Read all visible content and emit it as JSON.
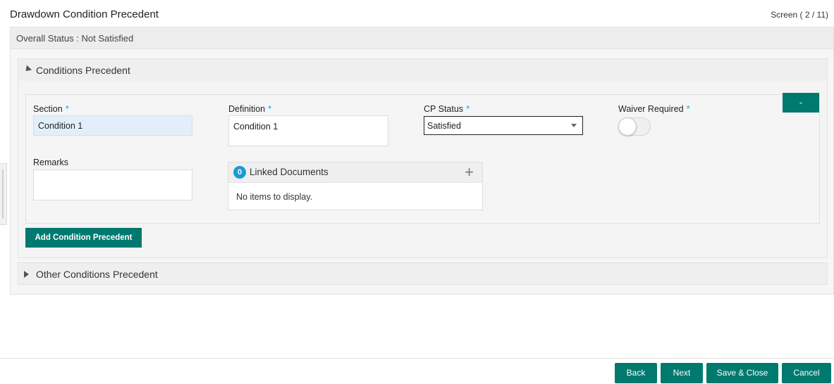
{
  "header": {
    "title": "Drawdown Condition Precedent",
    "screen_counter": "Screen ( 2 / 11)"
  },
  "overall_status": "Overall Status : Not Satisfied",
  "conditions_precedent": {
    "title": "Conditions Precedent",
    "remove_label": "-",
    "fields": {
      "section": {
        "label": "Section",
        "value": "Condition 1"
      },
      "definition": {
        "label": "Definition",
        "value": "Condition 1"
      },
      "cp_status": {
        "label": "CP Status",
        "value": "Satisfied"
      },
      "waiver_required": {
        "label": "Waiver Required"
      },
      "remarks": {
        "label": "Remarks",
        "value": ""
      }
    },
    "required_mark": "*",
    "linked_documents": {
      "count": "0",
      "title": "Linked Documents",
      "add_symbol": "+",
      "empty_text": "No items to display."
    },
    "add_button": "Add Condition Precedent"
  },
  "other_conditions": {
    "title": "Other Conditions Precedent"
  },
  "footer": {
    "back": "Back",
    "next": "Next",
    "save_close": "Save & Close",
    "cancel": "Cancel"
  },
  "colors": {
    "primary": "#00796f",
    "accent": "#1d9ad6"
  }
}
